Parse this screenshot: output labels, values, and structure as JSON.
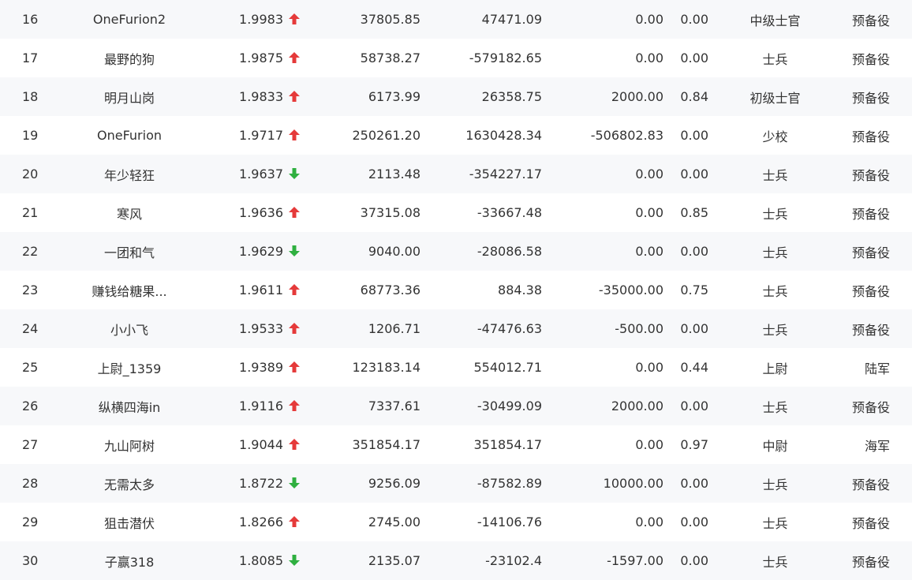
{
  "colors": {
    "up": "#e53a3a",
    "down": "#2fb040"
  },
  "rows": [
    {
      "rank": "16",
      "name": "OneFurion2",
      "ratio": "1.9983",
      "trend": "up",
      "v1": "37805.85",
      "v2": "47471.09",
      "v3": "0.00",
      "v4": "0.00",
      "title": "中级士官",
      "army": "预备役"
    },
    {
      "rank": "17",
      "name": "最野的狗",
      "ratio": "1.9875",
      "trend": "up",
      "v1": "58738.27",
      "v2": "-579182.65",
      "v3": "0.00",
      "v4": "0.00",
      "title": "士兵",
      "army": "预备役"
    },
    {
      "rank": "18",
      "name": "明月山岗",
      "ratio": "1.9833",
      "trend": "up",
      "v1": "6173.99",
      "v2": "26358.75",
      "v3": "2000.00",
      "v4": "0.84",
      "title": "初级士官",
      "army": "预备役"
    },
    {
      "rank": "19",
      "name": "OneFurion",
      "ratio": "1.9717",
      "trend": "up",
      "v1": "250261.20",
      "v2": "1630428.34",
      "v3": "-506802.83",
      "v4": "0.00",
      "title": "少校",
      "army": "预备役"
    },
    {
      "rank": "20",
      "name": "年少轻狂",
      "ratio": "1.9637",
      "trend": "down",
      "v1": "2113.48",
      "v2": "-354227.17",
      "v3": "0.00",
      "v4": "0.00",
      "title": "士兵",
      "army": "预备役"
    },
    {
      "rank": "21",
      "name": "寒风",
      "ratio": "1.9636",
      "trend": "up",
      "v1": "37315.08",
      "v2": "-33667.48",
      "v3": "0.00",
      "v4": "0.85",
      "title": "士兵",
      "army": "预备役"
    },
    {
      "rank": "22",
      "name": "一团和气",
      "ratio": "1.9629",
      "trend": "down",
      "v1": "9040.00",
      "v2": "-28086.58",
      "v3": "0.00",
      "v4": "0.00",
      "title": "士兵",
      "army": "预备役"
    },
    {
      "rank": "23",
      "name": "赚钱给糖果...",
      "ratio": "1.9611",
      "trend": "up",
      "v1": "68773.36",
      "v2": "884.38",
      "v3": "-35000.00",
      "v4": "0.75",
      "title": "士兵",
      "army": "预备役"
    },
    {
      "rank": "24",
      "name": "小小飞",
      "ratio": "1.9533",
      "trend": "up",
      "v1": "1206.71",
      "v2": "-47476.63",
      "v3": "-500.00",
      "v4": "0.00",
      "title": "士兵",
      "army": "预备役"
    },
    {
      "rank": "25",
      "name": "上尉_1359",
      "ratio": "1.9389",
      "trend": "up",
      "v1": "123183.14",
      "v2": "554012.71",
      "v3": "0.00",
      "v4": "0.44",
      "title": "上尉",
      "army": "陆军"
    },
    {
      "rank": "26",
      "name": "纵横四海in",
      "ratio": "1.9116",
      "trend": "up",
      "v1": "7337.61",
      "v2": "-30499.09",
      "v3": "2000.00",
      "v4": "0.00",
      "title": "士兵",
      "army": "预备役"
    },
    {
      "rank": "27",
      "name": "九山阿树",
      "ratio": "1.9044",
      "trend": "up",
      "v1": "351854.17",
      "v2": "351854.17",
      "v3": "0.00",
      "v4": "0.97",
      "title": "中尉",
      "army": "海军"
    },
    {
      "rank": "28",
      "name": "无需太多",
      "ratio": "1.8722",
      "trend": "down",
      "v1": "9256.09",
      "v2": "-87582.89",
      "v3": "10000.00",
      "v4": "0.00",
      "title": "士兵",
      "army": "预备役"
    },
    {
      "rank": "29",
      "name": "狙击潜伏",
      "ratio": "1.8266",
      "trend": "up",
      "v1": "2745.00",
      "v2": "-14106.76",
      "v3": "0.00",
      "v4": "0.00",
      "title": "士兵",
      "army": "预备役"
    },
    {
      "rank": "30",
      "name": "子赢318",
      "ratio": "1.8085",
      "trend": "down",
      "v1": "2135.07",
      "v2": "-23102.4",
      "v3": "-1597.00",
      "v4": "0.00",
      "title": "士兵",
      "army": "预备役"
    }
  ]
}
